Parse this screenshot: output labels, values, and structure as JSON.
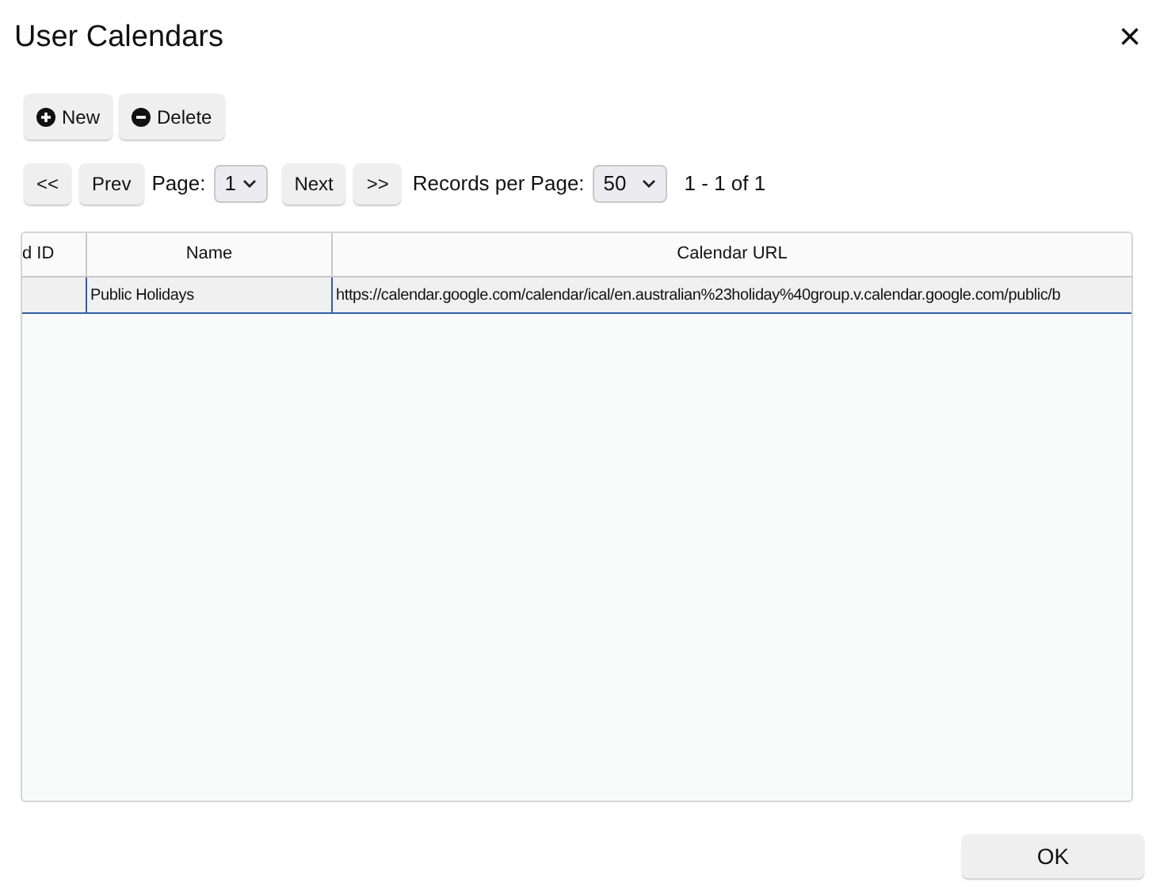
{
  "window": {
    "title": "User Calendars",
    "close": "×"
  },
  "toolbar": [
    {
      "kind": "add",
      "label": "New"
    },
    {
      "kind": "remove",
      "label": "Delete"
    }
  ],
  "pager": {
    "first": "<<",
    "prev": "Prev",
    "page_label": "Page:",
    "page": "1",
    "next": "Next",
    "last": ">>",
    "per_page_label": "Records per Page:",
    "per_page": "50",
    "range": "1 - 1 of 1"
  },
  "table": {
    "columns": [
      "d ID",
      "Name",
      "Calendar URL"
    ],
    "rows": [
      {
        "selected": true,
        "cells": [
          "",
          "Public Holidays",
          "https://calendar.google.com/calendar/ical/en.australian%23holiday%40group.v.calendar.google.com/public/b"
        ]
      }
    ]
  },
  "ok": "OK"
}
